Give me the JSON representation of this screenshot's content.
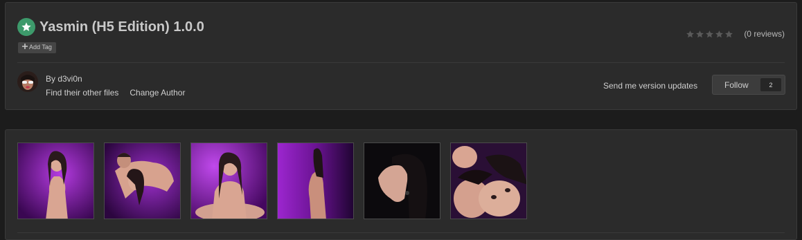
{
  "file": {
    "title": "Yasmin (H5 Edition) 1.0.0",
    "add_tag_label": "Add Tag"
  },
  "rating": {
    "stars_filled": 0,
    "stars_total": 5,
    "reviews_text": "(0 reviews)"
  },
  "author": {
    "by_text": "By d3vi0n",
    "links": [
      "Find their other files",
      "Change Author"
    ]
  },
  "actions": {
    "version_updates_label": "Send me version updates",
    "follow_label": "Follow",
    "follow_count": "2"
  },
  "gallery": {
    "thumbnails": [
      {
        "name": "thumbnail-1"
      },
      {
        "name": "thumbnail-2"
      },
      {
        "name": "thumbnail-3"
      },
      {
        "name": "thumbnail-4"
      },
      {
        "name": "thumbnail-5"
      },
      {
        "name": "thumbnail-6"
      }
    ]
  },
  "colors": {
    "badge_green": "#3d9a6b",
    "card_bg": "#2b2b2b",
    "page_bg": "#1c1c1c",
    "thumb_purple": "#8a1fb0"
  },
  "icons": {
    "title_badge": "star-icon",
    "add_tag": "plus-icon",
    "rating": "star-outline-icon"
  }
}
